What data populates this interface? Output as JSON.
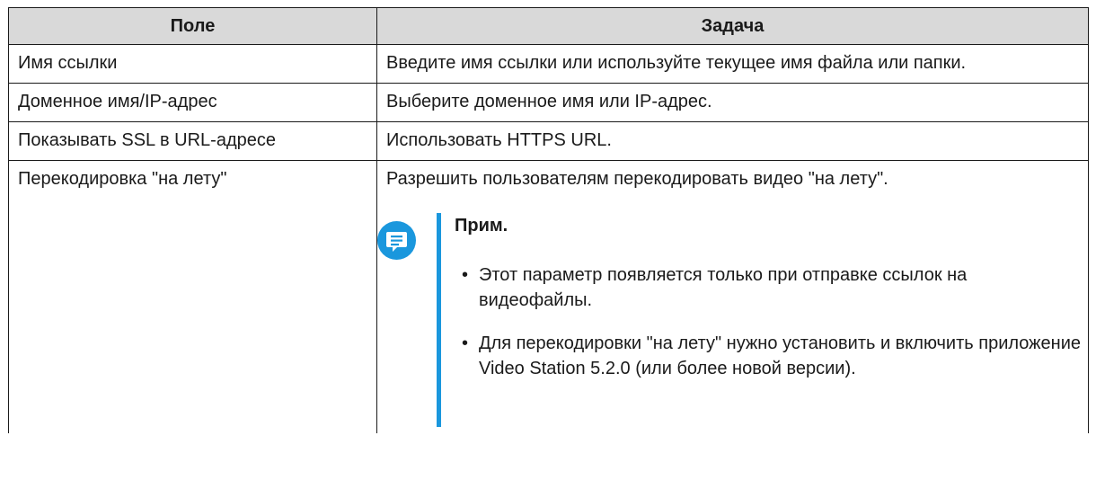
{
  "table": {
    "headers": [
      "Поле",
      "Задача"
    ],
    "rows": [
      {
        "field": "Имя ссылки",
        "task": "Введите имя ссылки или используйте текущее имя файла или папки."
      },
      {
        "field": "Доменное имя/IP-адрес",
        "task": "Выберите доменное имя или IP-адрес."
      },
      {
        "field": "Показывать SSL в URL-адресе",
        "task": "Использовать HTTPS URL."
      },
      {
        "field": "Перекодировка \"на лету\"",
        "task": "Разрешить пользователям перекодировать видео \"на лету\"."
      }
    ]
  },
  "note": {
    "icon": "note-icon",
    "accent_color": "#1a97dd",
    "title": "Прим.",
    "bullet": "•",
    "items": [
      "Этот параметр появляется только при отправке ссылок на видеофайлы.",
      "Для перекодировки \"на лету\" нужно установить и включить приложение Video Station 5.2.0 (или более новой версии)."
    ]
  }
}
